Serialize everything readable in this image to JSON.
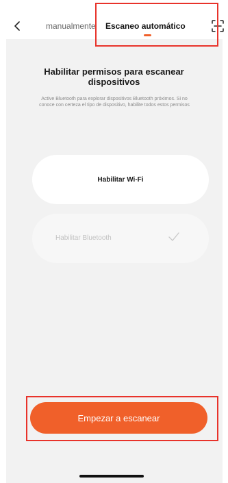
{
  "header": {
    "tab_manual": "manualmente",
    "tab_auto": "Escaneo automático",
    "active_tab": "tab_auto"
  },
  "main": {
    "title": "Habilitar permisos para escanear dispositivos",
    "description": "Active Bluetooth para explorar dispositivos Bluetooth próximos. Si no conoce con certeza el tipo de dispositivo, habilite todos estos permisos",
    "permissions": [
      {
        "label": "Habilitar Wi-Fi",
        "enabled": false
      },
      {
        "label": "Habilitar Bluetooth",
        "enabled": true
      }
    ]
  },
  "footer": {
    "start_label": "Empezar a escanear"
  },
  "icons": {
    "back": "chevron-left-icon",
    "scan": "scan-frame-icon",
    "check": "checkmark-icon"
  },
  "colors": {
    "accent": "#f0602a",
    "highlight": "#e8332b",
    "content_background": "#f2f2f2"
  }
}
